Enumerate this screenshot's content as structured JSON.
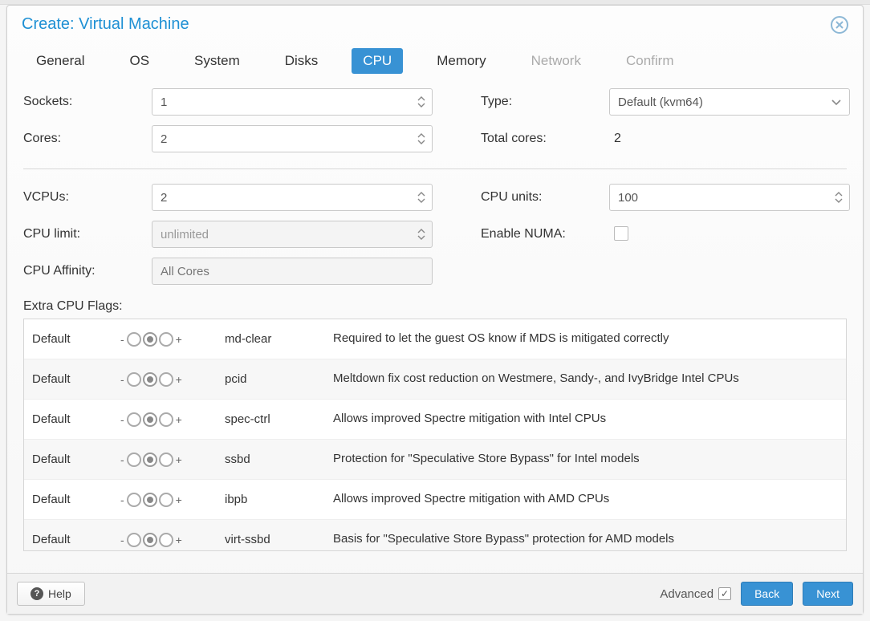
{
  "dialog": {
    "title": "Create: Virtual Machine"
  },
  "tabs": [
    {
      "label": "General",
      "state": "normal"
    },
    {
      "label": "OS",
      "state": "normal"
    },
    {
      "label": "System",
      "state": "normal"
    },
    {
      "label": "Disks",
      "state": "normal"
    },
    {
      "label": "CPU",
      "state": "active"
    },
    {
      "label": "Memory",
      "state": "normal"
    },
    {
      "label": "Network",
      "state": "disabled"
    },
    {
      "label": "Confirm",
      "state": "disabled"
    }
  ],
  "fields": {
    "sockets_label": "Sockets:",
    "sockets_value": "1",
    "cores_label": "Cores:",
    "cores_value": "2",
    "type_label": "Type:",
    "type_value": "Default (kvm64)",
    "total_cores_label": "Total cores:",
    "total_cores_value": "2",
    "vcpus_label": "VCPUs:",
    "vcpus_value": "2",
    "cpu_units_label": "CPU units:",
    "cpu_units_value": "100",
    "cpu_limit_label": "CPU limit:",
    "cpu_limit_value": "unlimited",
    "enable_numa_label": "Enable NUMA:",
    "cpu_affinity_label": "CPU Affinity:",
    "cpu_affinity_placeholder": "All Cores"
  },
  "flags_section_label": "Extra CPU Flags:",
  "flag_state_default": "Default",
  "flags": [
    {
      "name": "md-clear",
      "desc": "Required to let the guest OS know if MDS is mitigated correctly"
    },
    {
      "name": "pcid",
      "desc": "Meltdown fix cost reduction on Westmere, Sandy-, and IvyBridge Intel CPUs"
    },
    {
      "name": "spec-ctrl",
      "desc": "Allows improved Spectre mitigation with Intel CPUs"
    },
    {
      "name": "ssbd",
      "desc": "Protection for \"Speculative Store Bypass\" for Intel models"
    },
    {
      "name": "ibpb",
      "desc": "Allows improved Spectre mitigation with AMD CPUs"
    },
    {
      "name": "virt-ssbd",
      "desc": "Basis for \"Speculative Store Bypass\" protection for AMD models"
    }
  ],
  "footer": {
    "help": "Help",
    "advanced": "Advanced",
    "advanced_checked": true,
    "back": "Back",
    "next": "Next"
  }
}
